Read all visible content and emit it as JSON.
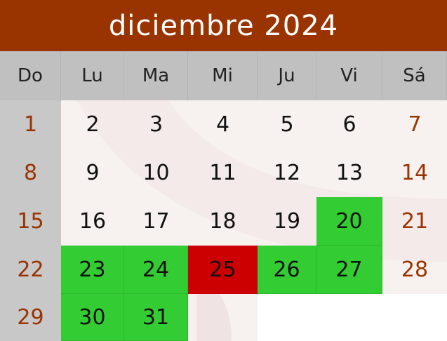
{
  "title": "diciembre 2024",
  "weekdays": [
    "Do",
    "Lu",
    "Ma",
    "Mi",
    "Ju",
    "Vi",
    "Sá"
  ],
  "weeks": [
    [
      {
        "d": "1",
        "s": "sun"
      },
      {
        "d": "2",
        "s": ""
      },
      {
        "d": "3",
        "s": ""
      },
      {
        "d": "4",
        "s": ""
      },
      {
        "d": "5",
        "s": ""
      },
      {
        "d": "6",
        "s": ""
      },
      {
        "d": "7",
        "s": "sat"
      }
    ],
    [
      {
        "d": "8",
        "s": "sun"
      },
      {
        "d": "9",
        "s": ""
      },
      {
        "d": "10",
        "s": ""
      },
      {
        "d": "11",
        "s": ""
      },
      {
        "d": "12",
        "s": ""
      },
      {
        "d": "13",
        "s": ""
      },
      {
        "d": "14",
        "s": "sat"
      }
    ],
    [
      {
        "d": "15",
        "s": "sun"
      },
      {
        "d": "16",
        "s": ""
      },
      {
        "d": "17",
        "s": ""
      },
      {
        "d": "18",
        "s": ""
      },
      {
        "d": "19",
        "s": ""
      },
      {
        "d": "20",
        "s": "green"
      },
      {
        "d": "21",
        "s": "sat"
      }
    ],
    [
      {
        "d": "22",
        "s": "sun"
      },
      {
        "d": "23",
        "s": "green"
      },
      {
        "d": "24",
        "s": "green"
      },
      {
        "d": "25",
        "s": "red"
      },
      {
        "d": "26",
        "s": "green"
      },
      {
        "d": "27",
        "s": "green"
      },
      {
        "d": "28",
        "s": "sat"
      }
    ],
    [
      {
        "d": "29",
        "s": "sun"
      },
      {
        "d": "30",
        "s": "green"
      },
      {
        "d": "31",
        "s": "green"
      },
      {
        "d": "",
        "s": "empty"
      },
      {
        "d": "",
        "s": "empty"
      },
      {
        "d": "",
        "s": "empty"
      },
      {
        "d": "",
        "s": "empty"
      }
    ]
  ],
  "colors": {
    "header_bg": "#993300",
    "weekday_bg": "#c0c0c0",
    "sunday_bg": "#c8c8c8",
    "weekend_text": "#993300",
    "highlight_green": "#33cc33",
    "highlight_red": "#cc0000"
  }
}
